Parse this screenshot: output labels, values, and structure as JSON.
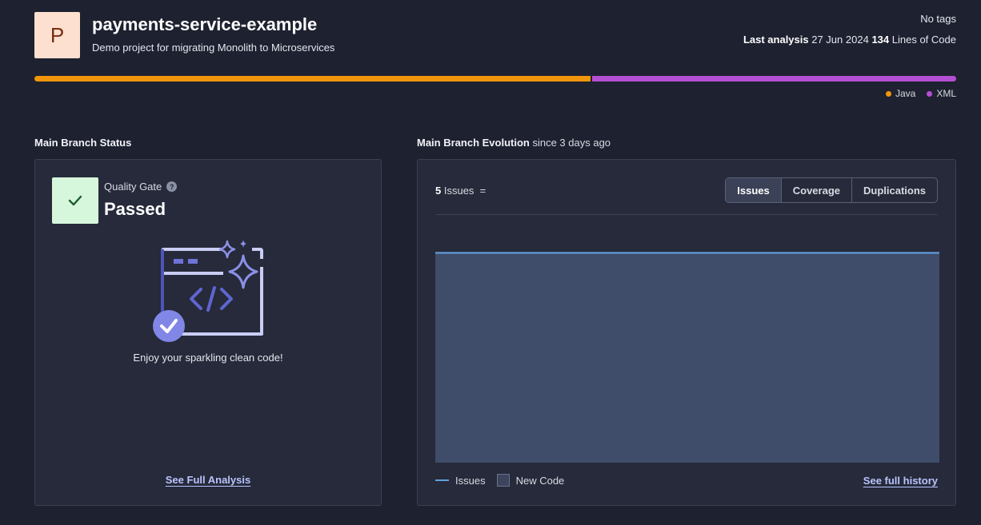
{
  "project": {
    "avatar_letter": "P",
    "name": "payments-service-example",
    "description": "Demo project for migrating Monolith to Microservices",
    "tags": "No tags",
    "last_analysis_label": "Last analysis",
    "last_analysis_date": "27 Jun 2024",
    "lines_count": "134",
    "lines_label": "Lines of Code"
  },
  "languages": [
    {
      "name": "Java",
      "color": "#f0950c",
      "share": 0.604
    },
    {
      "name": "XML",
      "color": "#b44fd4",
      "share": 0.396
    }
  ],
  "main_branch_status": {
    "heading": "Main Branch Status",
    "quality_gate_label": "Quality Gate",
    "quality_gate_status": "Passed",
    "message": "Enjoy your sparkling clean code!",
    "link": "See Full Analysis"
  },
  "main_branch_evolution": {
    "heading": "Main Branch Evolution",
    "since": "since 3 days ago",
    "issues_count": "5",
    "issues_label": "Issues",
    "issues_trend_symbol": "=",
    "tabs": [
      {
        "label": "Issues",
        "active": true
      },
      {
        "label": "Coverage",
        "active": false
      },
      {
        "label": "Duplications",
        "active": false
      }
    ],
    "legend": {
      "issues": "Issues",
      "new_code": "New Code"
    },
    "link": "See full history"
  },
  "colors": {
    "background": "#1e2130",
    "panel": "#262a3a",
    "new_code_area": "#3f4d6a",
    "issues_line": "#5fa0dc",
    "passed_bg": "#d7f7dd",
    "link": "#b9c4ff"
  }
}
